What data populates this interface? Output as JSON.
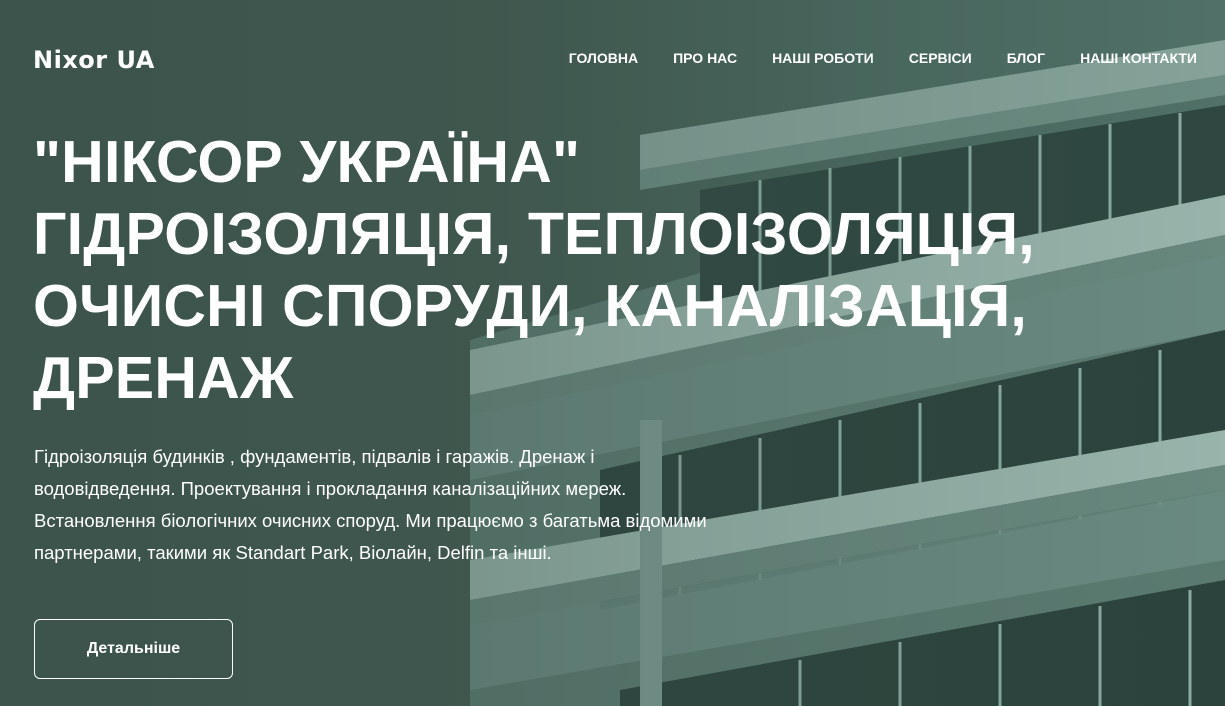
{
  "header": {
    "logo": "Nixor UA",
    "nav": [
      {
        "label": "ГОЛОВНА"
      },
      {
        "label": "ПРО НАС"
      },
      {
        "label": "НАШІ РОБОТИ"
      },
      {
        "label": "СЕРВІСИ"
      },
      {
        "label": "БЛОГ"
      },
      {
        "label": "НАШІ КОНТАКТИ"
      }
    ]
  },
  "hero": {
    "headline_lines": [
      "\"НІКСОР УКРАЇНА\"",
      "ГІДРОІЗОЛЯЦІЯ, ТЕПЛОІЗОЛЯЦІЯ,",
      "ОЧИСНІ СПОРУДИ, КАНАЛІЗАЦІЯ,",
      "ДРЕНАЖ"
    ],
    "description": "Гідроізоляція будинків , фундаментів, підвалів і гаражів. Дренаж і водовідведення. Проектування і прокладання каналізаційних мереж. Встановлення біологічних очисних споруд. Ми працюємо з багатьма відомими партнерами, такими як Standart Park, Віолайн, Delfin та інші.",
    "cta_label": "Детальніше"
  },
  "colors": {
    "background": "#3f5a51",
    "text": "#ffffff"
  }
}
